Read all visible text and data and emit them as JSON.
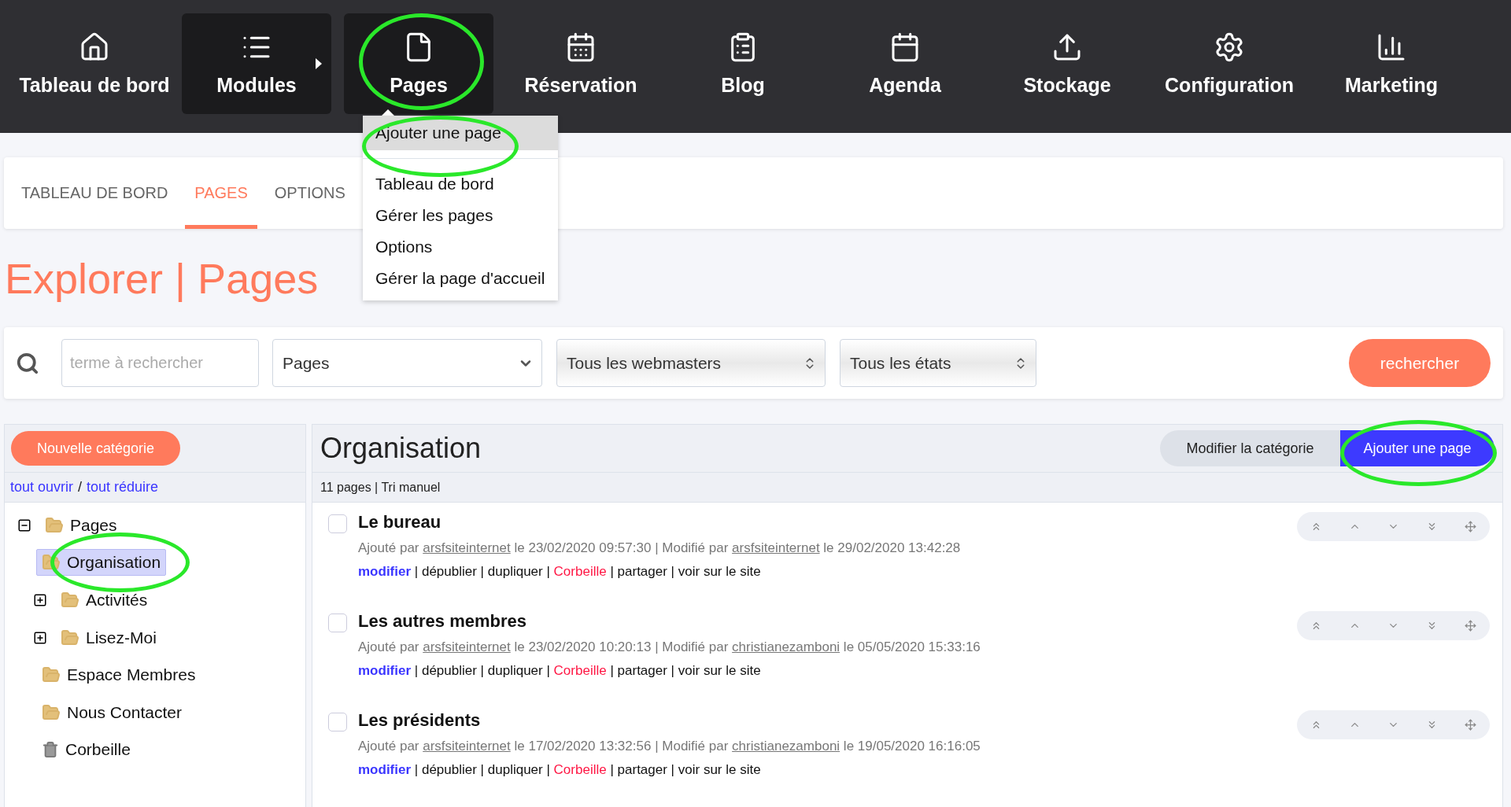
{
  "nav": [
    {
      "label": "Tableau de bord",
      "highlighted": false,
      "submenu": false,
      "circled": false
    },
    {
      "label": "Modules",
      "highlighted": true,
      "submenu": true,
      "circled": false
    },
    {
      "label": "Pages",
      "highlighted": true,
      "submenu": false,
      "circled": true
    },
    {
      "label": "Réservation",
      "highlighted": false,
      "submenu": false,
      "circled": false
    },
    {
      "label": "Blog",
      "highlighted": false,
      "submenu": false,
      "circled": false
    },
    {
      "label": "Agenda",
      "highlighted": false,
      "submenu": false,
      "circled": false
    },
    {
      "label": "Stockage",
      "highlighted": false,
      "submenu": false,
      "circled": false
    },
    {
      "label": "Configuration",
      "highlighted": false,
      "submenu": false,
      "circled": false
    },
    {
      "label": "Marketing",
      "highlighted": false,
      "submenu": false,
      "circled": false
    }
  ],
  "menu": {
    "primary": {
      "label": "Ajouter une page",
      "selected": true,
      "circled": true
    },
    "items": [
      "Tableau de bord",
      "Gérer les pages",
      "Options",
      "Gérer la page d'accueil"
    ]
  },
  "tabs": [
    {
      "label": "TABLEAU DE BORD",
      "selected": false
    },
    {
      "label": "PAGES",
      "selected": true
    },
    {
      "label": "OPTIONS",
      "selected": false
    }
  ],
  "title": "Explorer | Pages",
  "search": {
    "placeholder": "terme à rechercher",
    "section": "Pages",
    "webmaster": "Tous les webmasters",
    "state": "Tous les états",
    "button": "rechercher"
  },
  "sidebar": {
    "new_button": "Nouvelle catégorie",
    "expand_all": "tout ouvrir",
    "slash": "/",
    "collapse_all": "tout réduire",
    "tree": [
      {
        "label": "Pages",
        "kind": "expanded",
        "selected": false,
        "circled": false,
        "children": [
          {
            "label": "Organisation",
            "kind": "leaf",
            "selected": true,
            "circled": true
          },
          {
            "label": "Activités",
            "kind": "collapsed",
            "selected": false,
            "circled": false
          },
          {
            "label": "Lisez-Moi",
            "kind": "collapsed",
            "selected": false,
            "circled": false
          },
          {
            "label": "Espace Membres",
            "kind": "leaf",
            "selected": false,
            "circled": false
          },
          {
            "label": "Nous Contacter",
            "kind": "leaf",
            "selected": false,
            "circled": false
          },
          {
            "label": "Corbeille",
            "kind": "trash",
            "selected": false,
            "circled": false
          }
        ]
      }
    ]
  },
  "content": {
    "title": "Organisation",
    "edit_button": "Modifier la catégorie",
    "add_button": {
      "label": "Ajouter une page",
      "circled": true
    },
    "summary": "11 pages | Tri manuel",
    "separator": "|",
    "pages": [
      {
        "title": "Le bureau",
        "checked": false,
        "meta": [
          "Ajouté par",
          "arsfsiteinternet",
          "le 23/02/2020 09:57:30 | Modifié par",
          "arsfsiteinternet",
          "le 29/02/2020 13:42:28"
        ],
        "actions": [
          {
            "label": "modifier",
            "kind": "primary"
          },
          {
            "label": "dépublier",
            "kind": "plain"
          },
          {
            "label": "dupliquer",
            "kind": "plain"
          },
          {
            "label": "Corbeille",
            "kind": "danger"
          },
          {
            "label": "partager",
            "kind": "plain"
          },
          {
            "label": "voir sur le site",
            "kind": "plain"
          }
        ]
      },
      {
        "title": "Les autres membres",
        "checked": false,
        "meta": [
          "Ajouté par",
          "arsfsiteinternet",
          "le 23/02/2020 10:20:13 | Modifié par",
          "christianezamboni",
          "le 05/05/2020 15:33:16"
        ],
        "actions": [
          {
            "label": "modifier",
            "kind": "primary"
          },
          {
            "label": "dépublier",
            "kind": "plain"
          },
          {
            "label": "dupliquer",
            "kind": "plain"
          },
          {
            "label": "Corbeille",
            "kind": "danger"
          },
          {
            "label": "partager",
            "kind": "plain"
          },
          {
            "label": "voir sur le site",
            "kind": "plain"
          }
        ]
      },
      {
        "title": "Les présidents",
        "checked": false,
        "meta": [
          "Ajouté par",
          "arsfsiteinternet",
          "le 17/02/2020 13:32:56 | Modifié par",
          "christianezamboni",
          "le 19/05/2020 16:16:05"
        ],
        "actions": [
          {
            "label": "modifier",
            "kind": "primary"
          },
          {
            "label": "dépublier",
            "kind": "plain"
          },
          {
            "label": "dupliquer",
            "kind": "plain"
          },
          {
            "label": "Corbeille",
            "kind": "danger"
          },
          {
            "label": "partager",
            "kind": "plain"
          },
          {
            "label": "voir sur le site",
            "kind": "plain"
          }
        ]
      }
    ]
  }
}
